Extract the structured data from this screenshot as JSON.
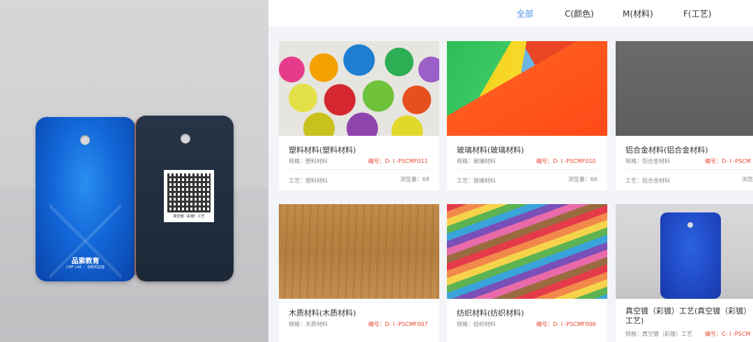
{
  "photo": {
    "brand": "品索教育",
    "brand_sub": "CMF LAB ｜ 创新实验室",
    "qr_caption": "真空镀（彩镀）工艺"
  },
  "tabs": [
    {
      "label": "全部",
      "active": true
    },
    {
      "label": "C(颜色)",
      "active": false
    },
    {
      "label": "M(材料)",
      "active": false
    },
    {
      "label": "F(工艺)",
      "active": false
    }
  ],
  "cards": [
    {
      "title": "塑料材料(塑料材料)",
      "spec": "规格：塑料材料",
      "code": "编号：D- I -PSCMF011",
      "craft": "工艺：塑料材料",
      "views": "浏览量：68"
    },
    {
      "title": "玻璃材料(玻璃材料)",
      "spec": "规格：玻璃材料",
      "code": "编号：D- I -PSCMF010",
      "craft": "工艺：玻璃材料",
      "views": "浏览量：66"
    },
    {
      "title": "铝合金材料(铝合金材料)",
      "spec": "规格：铝合金材料",
      "code": "编号：D- I -PSCM",
      "craft": "工艺：铝合金材料",
      "views": "浏览"
    },
    {
      "title": "木质材料(木质材料)",
      "spec": "规格：木质材料",
      "code": "编号：D- I -PSCMF007"
    },
    {
      "title": "纺织材料(纺织材料)",
      "spec": "规格：纺织材料",
      "code": "编号：D- I -PSCMF006"
    },
    {
      "title": "真空镀（彩镀）工艺(真空镀（彩镀）工艺)",
      "spec": "规格：真空镀（彩镀）工艺",
      "code": "编号：C- I -PSCM"
    }
  ],
  "colors": {
    "accent": "#4a90e2",
    "code_red": "#e8462f"
  }
}
